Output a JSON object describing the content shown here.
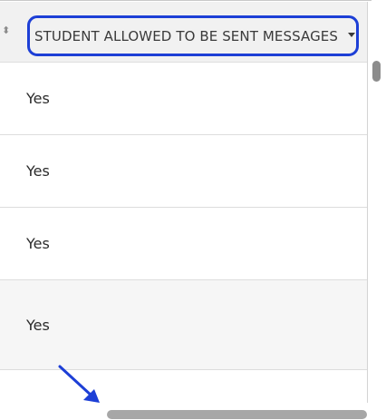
{
  "table": {
    "column_header": "STUDENT ALLOWED TO BE SENT MESSAGES",
    "rows": [
      {
        "value": "Yes"
      },
      {
        "value": "Yes"
      },
      {
        "value": "Yes"
      },
      {
        "value": "Yes"
      }
    ]
  },
  "colors": {
    "highlight_border": "#1d3fd6",
    "annotation_arrow": "#1d3fd6",
    "header_background": "#f1f1f1"
  },
  "icons": [
    "sort-icon",
    "dropdown-caret-icon",
    "annotation-arrow-icon"
  ]
}
